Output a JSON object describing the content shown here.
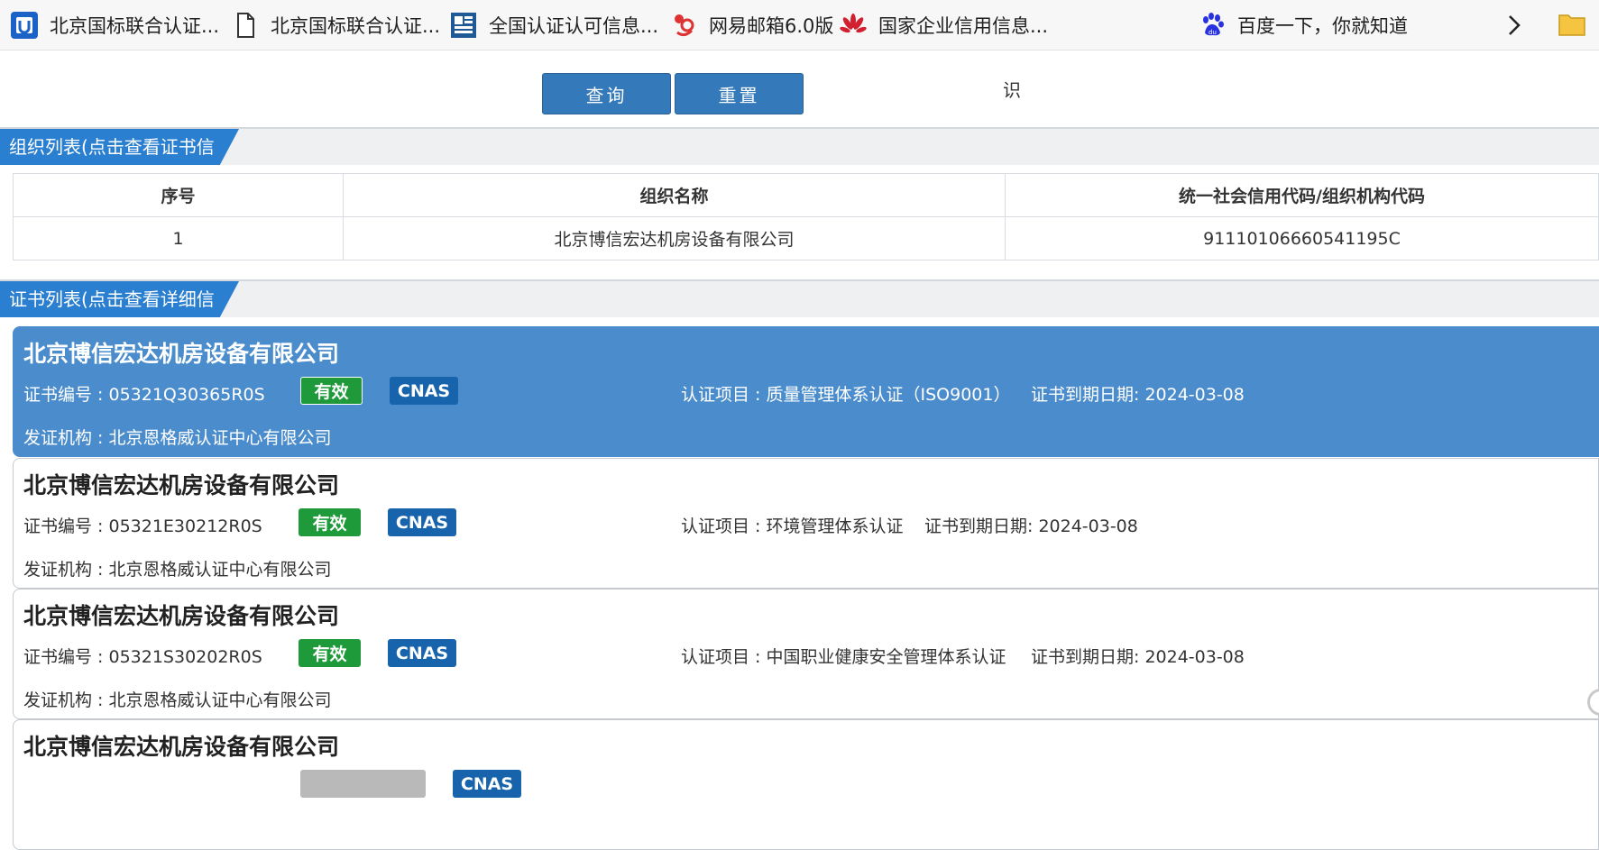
{
  "bookmarks": [
    {
      "label": "北京国标联合认证...",
      "icon": "blue-square-logo-icon"
    },
    {
      "label": "北京国标联合认证...",
      "icon": "document-icon"
    },
    {
      "label": "全国认证认可信息...",
      "icon": "cnca-logo-icon"
    },
    {
      "label": "网易邮箱6.0版",
      "icon": "netease-mail-icon"
    },
    {
      "label": "国家企业信用信息...",
      "icon": "huawei-style-logo-icon"
    },
    {
      "label": "百度一下，你就知道",
      "icon": "baidu-paw-icon"
    }
  ],
  "toolbar": {
    "query_label": "查询",
    "reset_label": "重置",
    "stray_text": "识"
  },
  "org_section": {
    "title": "组织列表(点击查看证书信息)"
  },
  "org_table": {
    "headers": [
      "序号",
      "组织名称",
      "统一社会信用代码/组织机构代码"
    ],
    "rows": [
      [
        "1",
        "北京博信宏达机房设备有限公司",
        "91110106660541195C"
      ]
    ]
  },
  "cert_section": {
    "title": "证书列表(点击查看详细信息)"
  },
  "certs": [
    {
      "name": "北京博信宏达机房设备有限公司",
      "number": "证书编号 : 05321Q30365R0S",
      "status": "有效",
      "accreditor": "CNAS",
      "project": "认证项目 : 质量管理体系认证（ISO9001）",
      "expiry": "证书到期日期: 2024-03-08",
      "issuer": "发证机构 : 北京恩格威认证中心有限公司"
    },
    {
      "name": "北京博信宏达机房设备有限公司",
      "number": "证书编号 : 05321E30212R0S",
      "status": "有效",
      "accreditor": "CNAS",
      "project": "认证项目 : 环境管理体系认证",
      "expiry": "证书到期日期: 2024-03-08",
      "issuer": "发证机构 : 北京恩格威认证中心有限公司"
    },
    {
      "name": "北京博信宏达机房设备有限公司",
      "number": "证书编号 : 05321S30202R0S",
      "status": "有效",
      "accreditor": "CNAS",
      "project": "认证项目 : 中国职业健康安全管理体系认证",
      "expiry": "证书到期日期: 2024-03-08",
      "issuer": "发证机构 : 北京恩格威认证中心有限公司"
    },
    {
      "name": "北京博信宏达机房设备有限公司",
      "number": "",
      "status": "",
      "accreditor": "CNAS",
      "project": "",
      "expiry": "",
      "issuer": ""
    }
  ],
  "colors": {
    "primary_button": "#3479b9",
    "section_tab": "#2b7fd0",
    "selected_card": "#4a8ccc",
    "valid_badge": "#1e9a3a",
    "cnas_badge": "#1764ad"
  }
}
